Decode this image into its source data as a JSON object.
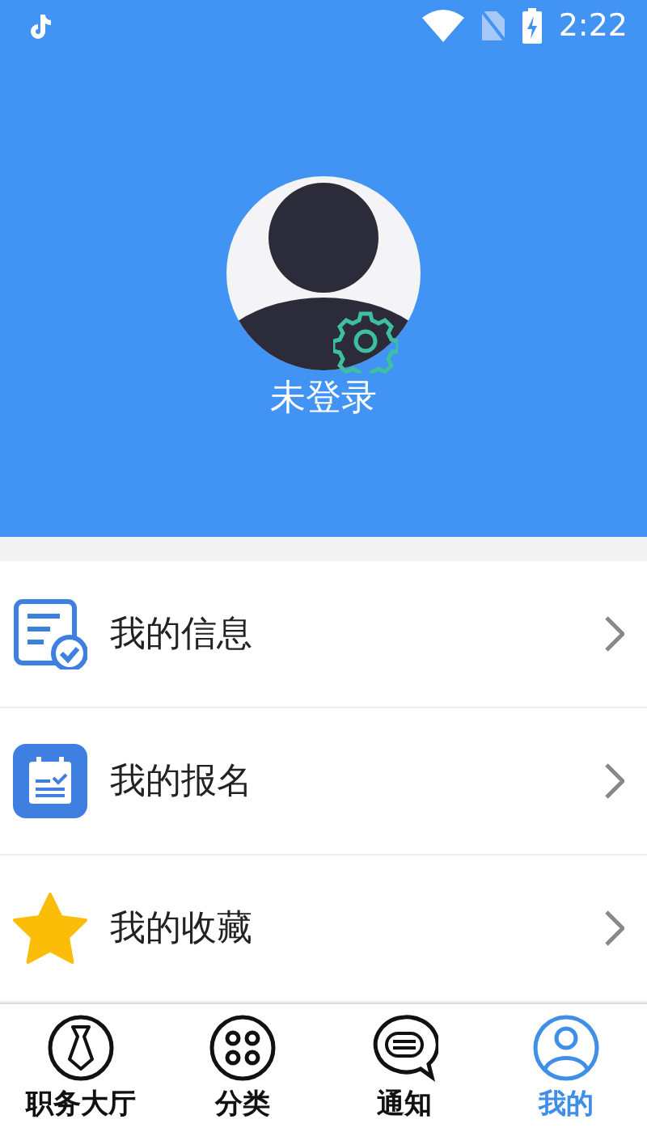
{
  "status_bar": {
    "time": "2:22"
  },
  "profile": {
    "name": "未登录"
  },
  "menu": [
    {
      "kind": "info",
      "label": "我的信息"
    },
    {
      "kind": "signup",
      "label": "我的报名"
    },
    {
      "kind": "favorite",
      "label": "我的收藏"
    }
  ],
  "tabs": [
    {
      "kind": "jobs",
      "label": "职务大厅",
      "selected": false
    },
    {
      "kind": "category",
      "label": "分类",
      "selected": false
    },
    {
      "kind": "notice",
      "label": "通知",
      "selected": false
    },
    {
      "kind": "me",
      "label": "我的",
      "selected": true
    }
  ]
}
